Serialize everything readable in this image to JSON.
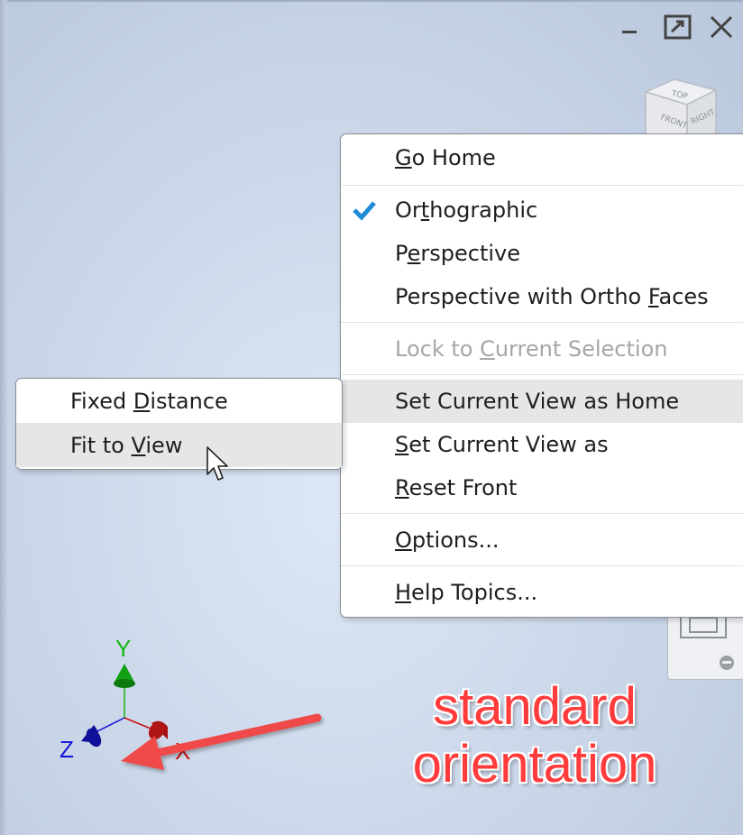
{
  "window_controls": {
    "minimize": "minimize",
    "maximize": "maximize",
    "close": "close"
  },
  "viewcube": {
    "top": "TOP",
    "front": "FRONT",
    "right": "RIGHT"
  },
  "context_menu": {
    "items": [
      {
        "label": "Go Home",
        "mnemonic": "G",
        "enabled": true
      },
      {
        "label": "Orthographic",
        "mnemonic": "t",
        "checked": true,
        "enabled": true
      },
      {
        "label": "Perspective",
        "mnemonic": "e",
        "enabled": true
      },
      {
        "label": "Perspective with Ortho Faces",
        "mnemonic": "F",
        "enabled": true
      },
      {
        "label": "Lock to Current Selection",
        "mnemonic": "C",
        "enabled": false
      },
      {
        "label": "Set Current View as Home",
        "submenu": true,
        "highlighted": true,
        "enabled": true
      },
      {
        "label": "Set Current View as",
        "mnemonic": "S",
        "submenu": true,
        "enabled": true
      },
      {
        "label": "Reset Front",
        "mnemonic": "R",
        "enabled": true
      },
      {
        "label": "Options...",
        "mnemonic": "O",
        "enabled": true
      },
      {
        "label": "Help Topics...",
        "mnemonic": "H",
        "enabled": true
      }
    ]
  },
  "submenu": {
    "items": [
      {
        "label": "Fixed Distance",
        "mnemonic": "D"
      },
      {
        "label": "Fit to View",
        "mnemonic": "V",
        "highlighted": true
      }
    ]
  },
  "axes": {
    "y": "Y",
    "z": "Z",
    "x": "X"
  },
  "annotation": {
    "line1": "standard",
    "line2": "orientation"
  },
  "colors": {
    "check": "#1f8ad6",
    "annotation": "#ff3b3b",
    "axis_y": "#15b515",
    "axis_z": "#1515d6",
    "axis_x": "#cc1111"
  }
}
